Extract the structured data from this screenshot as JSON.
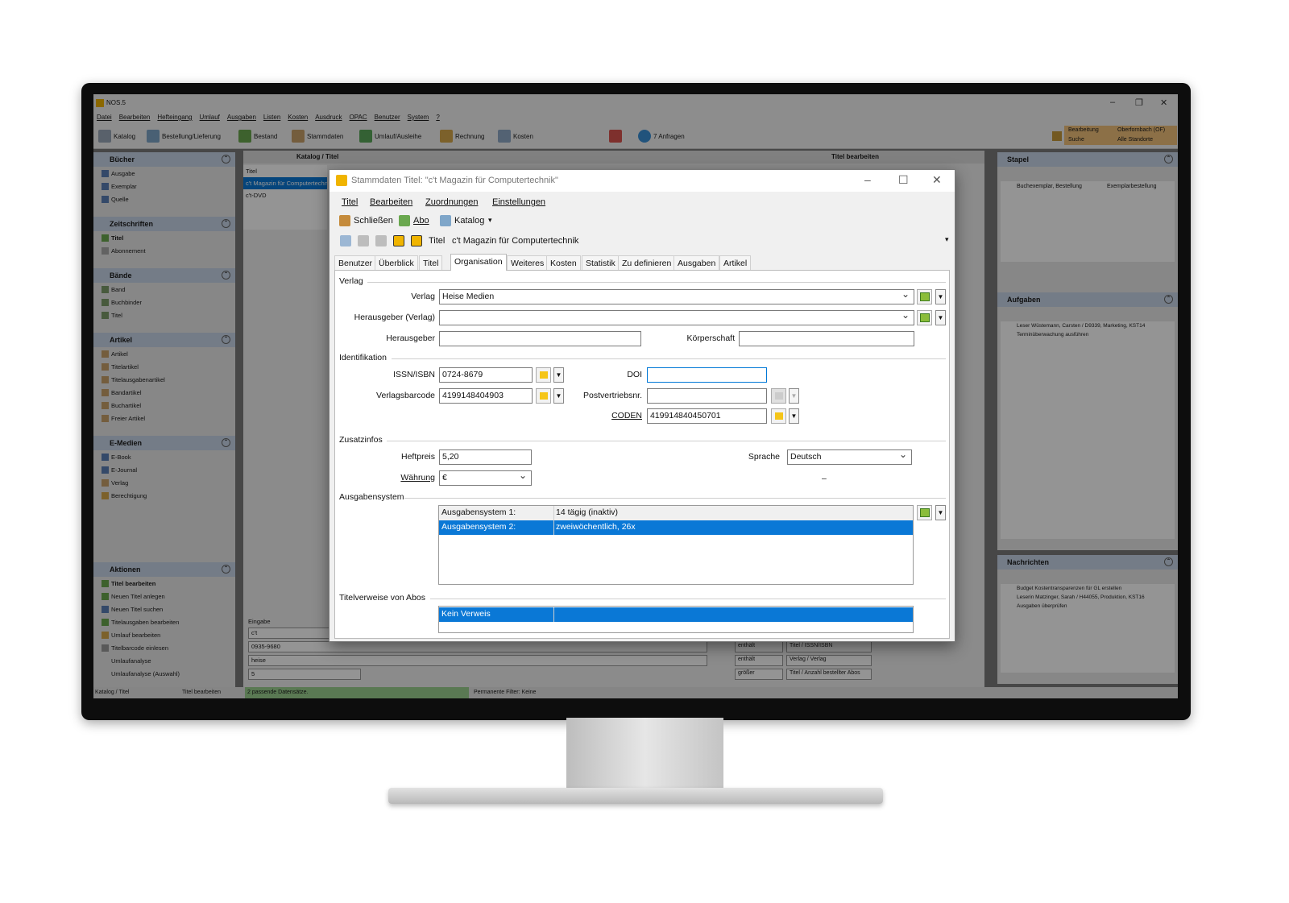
{
  "app": {
    "title": "NOS.5",
    "menu": [
      "Datei",
      "Bearbeiten",
      "Hefteingang",
      "Umlauf",
      "Ausgaben",
      "Listen",
      "Kosten",
      "Ausdruck",
      "OPAC",
      "Benutzer",
      "System",
      "?"
    ],
    "toolbar": {
      "katalog": "Katalog",
      "bestellung": "Bestellung/Lieferung",
      "bestand": "Bestand",
      "stammdaten": "Stammdaten",
      "umlauf": "Umlauf/Ausleihe",
      "rechnung": "Rechnung",
      "kosten": "Kosten",
      "anfragen": "7 Anfragen"
    },
    "context": {
      "bearbeitung": "Bearbeitung",
      "suche": "Suche",
      "ort": "Oberfornbach (OF)",
      "standorte": "Alle Standorte"
    },
    "breadcrumb": "Katalog / Titel",
    "edit_header": "Titel bearbeiten",
    "list": {
      "header": "Titel",
      "items": [
        "c't Magazin für Computertechnik",
        "c't-DVD"
      ]
    },
    "left": {
      "buecher": {
        "title": "Bücher",
        "items": [
          "Ausgabe",
          "Exemplar",
          "Quelle"
        ]
      },
      "zeitschriften": {
        "title": "Zeitschriften",
        "items": [
          "Titel",
          "Abonnement"
        ]
      },
      "baende": {
        "title": "Bände",
        "items": [
          "Band",
          "Buchbinder",
          "Titel"
        ]
      },
      "artikel": {
        "title": "Artikel",
        "items": [
          "Artikel",
          "Titelartikel",
          "Titelausgabenartikel",
          "Bandartikel",
          "Buchartikel",
          "Freier Artikel"
        ]
      },
      "emedien": {
        "title": "E-Medien",
        "items": [
          "E-Book",
          "E-Journal",
          "Verlag",
          "Berechtigung"
        ]
      },
      "aktionen": {
        "title": "Aktionen",
        "items": [
          "Titel bearbeiten",
          "Neuen Titel anlegen",
          "Neuen Titel suchen",
          "Titelausgaben bearbeiten",
          "Umlauf bearbeiten",
          "Titelbarcode einlesen",
          "Umlaufanalyse",
          "Umlaufanalyse (Auswahl)"
        ]
      }
    },
    "right": {
      "stapel": {
        "title": "Stapel",
        "row_a": "Buchexemplar, Bestellung",
        "row_b": "Exemplarbestellung"
      },
      "aufgaben": {
        "title": "Aufgaben",
        "items": [
          "Leser Wüstemann, Carsten / D9339, Marketing, KST14",
          "Terminüberwachung ausführen"
        ]
      },
      "nachrichten": {
        "title": "Nachrichten",
        "items": [
          "Budget Kostentransparenzen für GL erstellen",
          "Leserin Matzinger, Sarah / H44055, Produktion, KST16",
          "Ausgaben überprüfen"
        ]
      }
    },
    "filter": {
      "eingabe_label": "Eingabe",
      "rows": [
        {
          "value": "c't",
          "op": "",
          "field": ""
        },
        {
          "value": "0935-9680",
          "op": "enthält",
          "field": "Titel / ISSN/ISBN"
        },
        {
          "value": "heise",
          "op": "enthält",
          "field": "Verlag / Verlag"
        },
        {
          "value": "5",
          "op": "größer",
          "field": "Titel / Anzahl bestellter Abos"
        }
      ]
    },
    "status": {
      "a": "Katalog / Titel",
      "b": "Titel bearbeiten",
      "c": "2 passende Datensätze.",
      "d": "Permanente Filter: Keine"
    }
  },
  "dialog": {
    "title": "Stammdaten Titel: \"c't Magazin für Computertechnik\"",
    "menu": [
      "Titel",
      "Bearbeiten",
      "Zuordnungen",
      "Einstellungen"
    ],
    "toolbar": {
      "close": "Schließen",
      "abo": "Abo",
      "katalog": "Katalog"
    },
    "nav": {
      "label": "Titel",
      "value": "c't Magazin für Computertechnik"
    },
    "tabs": [
      "Benutzer",
      "Überblick",
      "Titel",
      "Organisation",
      "Weiteres",
      "Kosten",
      "Statistik",
      "Zu definieren",
      "Ausgaben",
      "Artikel"
    ],
    "active_tab": "Organisation",
    "verlag": {
      "section": "Verlag",
      "verlag_label": "Verlag",
      "verlag_value": "Heise Medien",
      "hrsg_verlag_label": "Herausgeber (Verlag)",
      "hrsg_verlag_value": "",
      "hrsg_label": "Herausgeber",
      "hrsg_value": "",
      "koerperschaft_label": "Körperschaft",
      "koerperschaft_value": ""
    },
    "ident": {
      "section": "Identifikation",
      "issn_label": "ISSN/ISBN",
      "issn_value": "0724-8679",
      "barcode_label": "Verlagsbarcode",
      "barcode_value": "4199148404903",
      "doi_label": "DOI",
      "doi_value": "",
      "postnr_label": "Postvertriebsnr.",
      "postnr_value": "",
      "coden_label": "CODEN",
      "coden_value": "419914840450701"
    },
    "zusatz": {
      "section": "Zusatzinfos",
      "heftpreis_label": "Heftpreis",
      "heftpreis_value": "5,20",
      "waehrung_label": "Währung",
      "waehrung_value": "€",
      "sprache_label": "Sprache",
      "sprache_value": "Deutsch",
      "dash": "–"
    },
    "ausgaben": {
      "section": "Ausgabensystem",
      "rows": [
        {
          "name": "Ausgabensystem 1:",
          "value": "14 tägig (inaktiv)"
        },
        {
          "name": "Ausgabensystem 2:",
          "value": "zweiwöchentlich, 26x"
        }
      ]
    },
    "verweise": {
      "section": "Titelverweise von Abos",
      "rows": [
        {
          "name": "Kein Verweis",
          "value": ""
        }
      ]
    }
  },
  "colors": {
    "selection": "#0a78d6",
    "panel_header": "#c9d6e8",
    "flag": "#f5c518"
  }
}
